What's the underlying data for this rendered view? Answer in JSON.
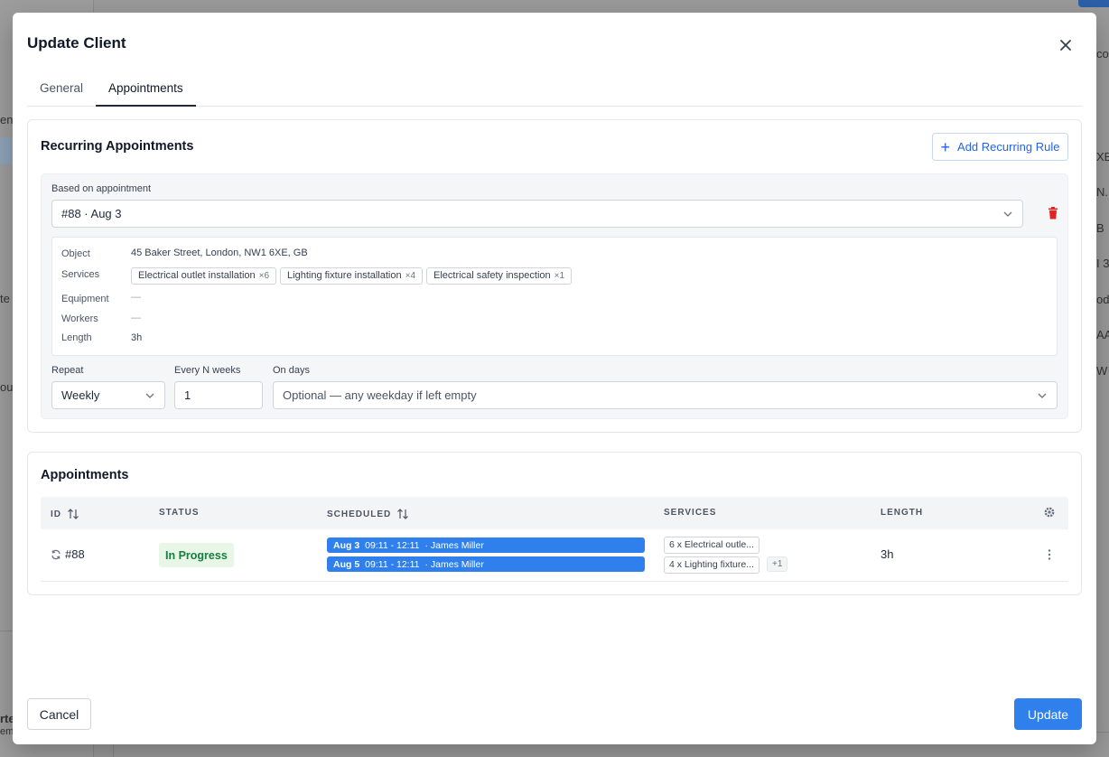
{
  "background": {
    "fragments": [
      "ent",
      "te",
      "our",
      "co",
      "XE",
      "N...",
      "B",
      "I 3",
      "od",
      "AA",
      "W",
      "rte",
      "em"
    ]
  },
  "modal": {
    "title": "Update Client",
    "tabs": [
      {
        "label": "General",
        "active": false
      },
      {
        "label": "Appointments",
        "active": true
      }
    ]
  },
  "recurring": {
    "title": "Recurring Appointments",
    "add_rule_label": "Add Recurring Rule",
    "based_on_label": "Based on appointment",
    "based_on_value": "#88 · Aug 3",
    "details": {
      "object_label": "Object",
      "object_value": "45 Baker Street, London, NW1 6XE, GB",
      "services_label": "Services",
      "services": [
        {
          "name": "Electrical outlet installation",
          "qty": "×6"
        },
        {
          "name": "Lighting fixture installation",
          "qty": "×4"
        },
        {
          "name": "Electrical safety inspection",
          "qty": "×1"
        }
      ],
      "equipment_label": "Equipment",
      "equipment_value": "—",
      "workers_label": "Workers",
      "workers_value": "—",
      "length_label": "Length",
      "length_value": "3h"
    },
    "repeat_label": "Repeat",
    "repeat_value": "Weekly",
    "every_n_label": "Every N weeks",
    "every_n_value": "1",
    "on_days_label": "On days",
    "on_days_placeholder": "Optional — any weekday if left empty"
  },
  "appointments": {
    "title": "Appointments",
    "columns": {
      "id": "ID",
      "status": "STATUS",
      "scheduled": "SCHEDULED",
      "services": "SERVICES",
      "length": "LENGTH"
    },
    "rows": [
      {
        "id": "#88",
        "status": "In Progress",
        "scheduled": [
          {
            "date": "Aug 3",
            "time": "09:11 - 12:11",
            "worker": "· James Miller"
          },
          {
            "date": "Aug 5",
            "time": "09:11 - 12:11",
            "worker": "· James Miller"
          }
        ],
        "services": [
          "6 x Electrical outle...",
          "4 x Lighting fixture..."
        ],
        "services_more": "+1",
        "length": "3h"
      }
    ]
  },
  "footer": {
    "cancel_label": "Cancel",
    "update_label": "Update"
  },
  "colors": {
    "accent": "#2f80ed",
    "danger": "#e02424",
    "status_green": "#15803d"
  }
}
